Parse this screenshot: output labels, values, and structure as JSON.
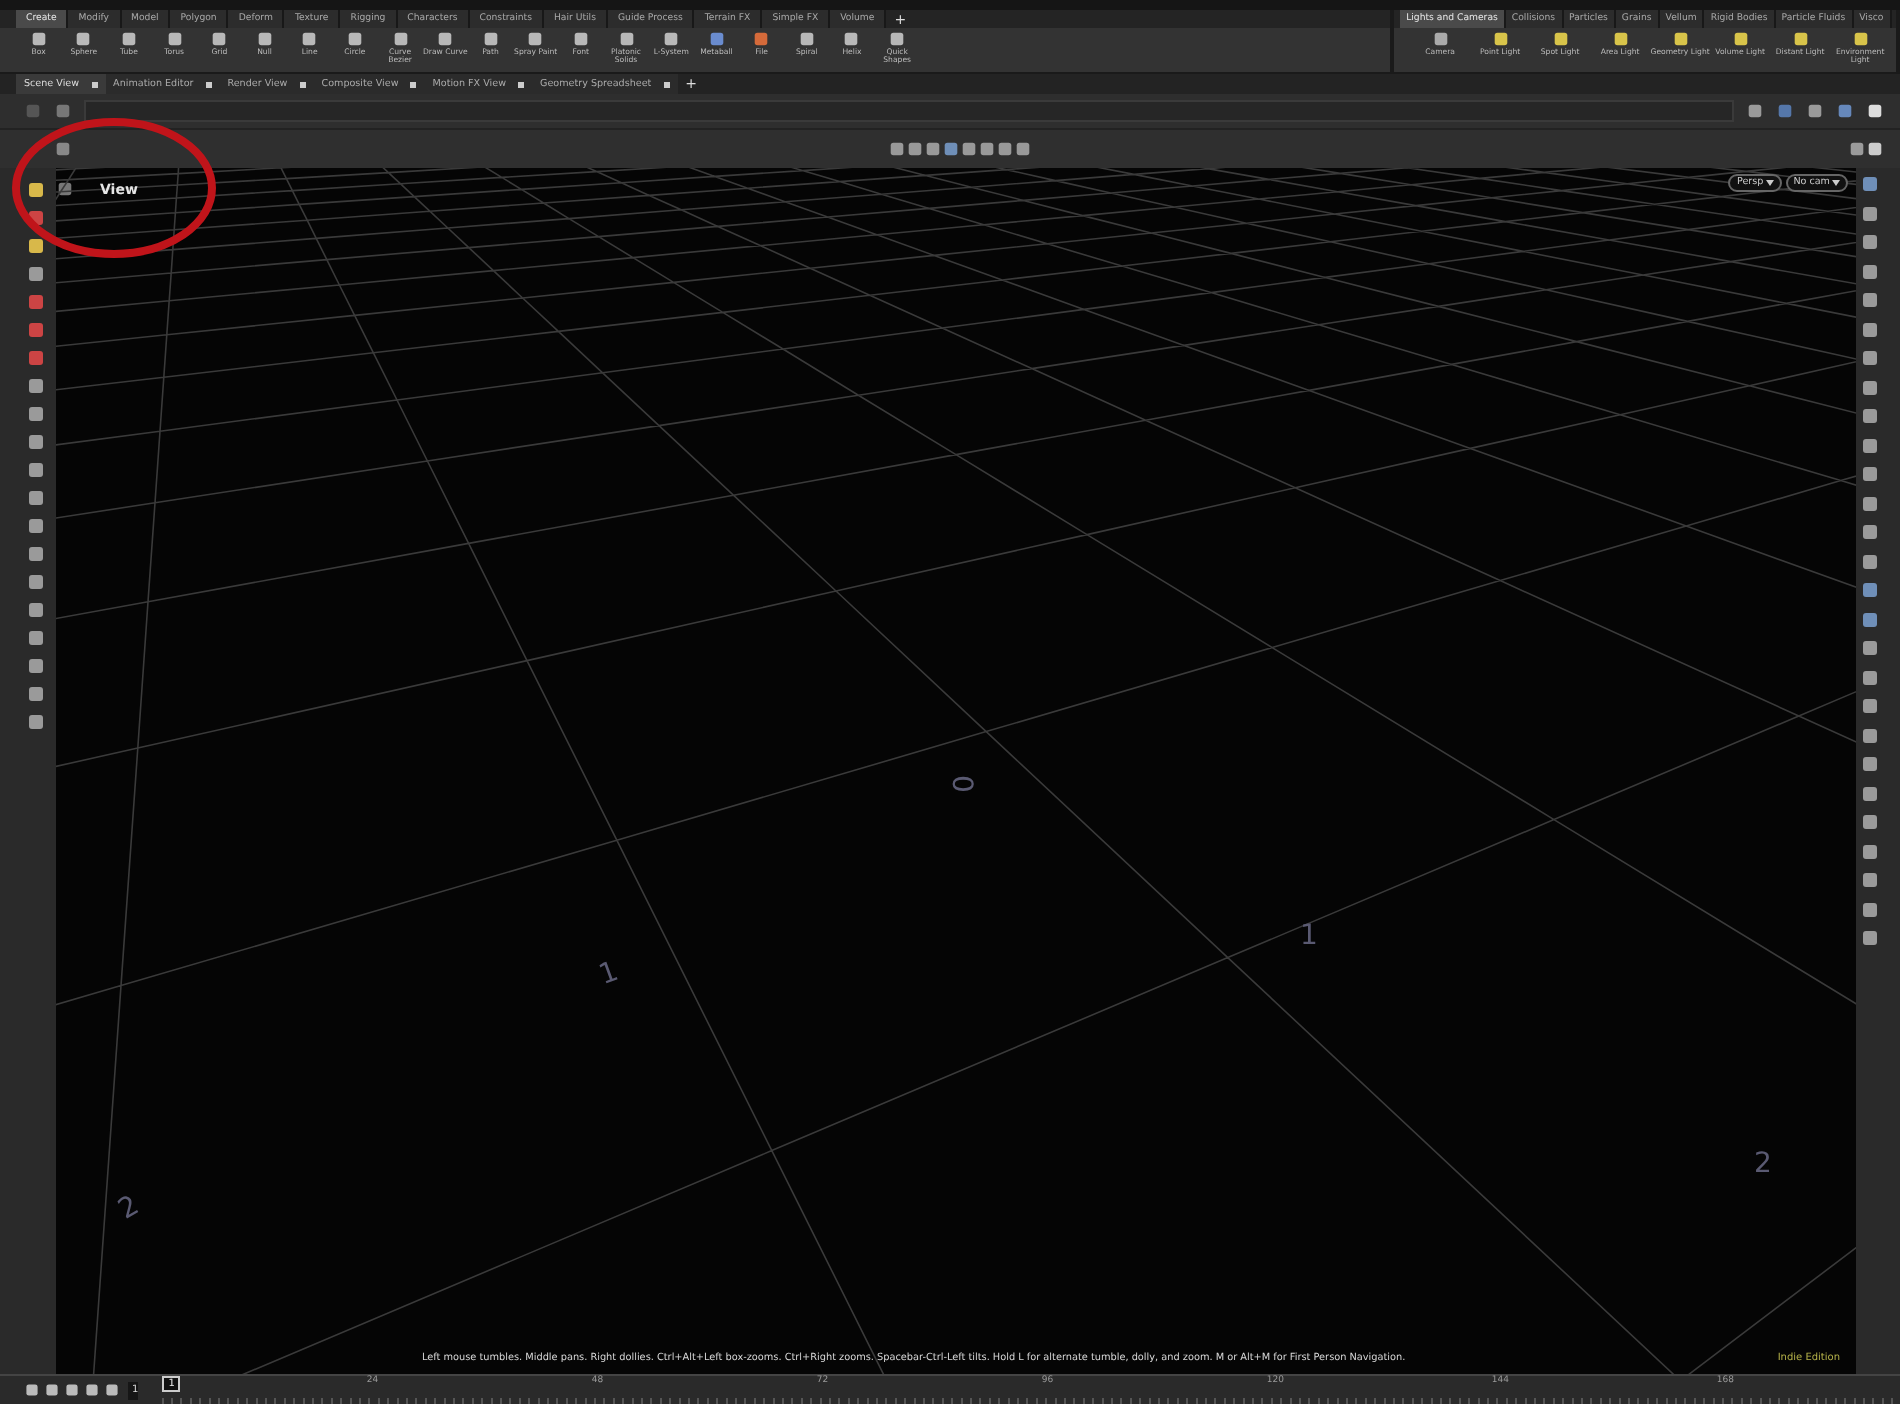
{
  "shelf_tabs": [
    {
      "label": "Create",
      "selected": true
    },
    {
      "label": "Modify",
      "selected": false
    },
    {
      "label": "Model",
      "selected": false
    },
    {
      "label": "Polygon",
      "selected": false
    },
    {
      "label": "Deform",
      "selected": false
    },
    {
      "label": "Texture",
      "selected": false
    },
    {
      "label": "Rigging",
      "selected": false
    },
    {
      "label": "Characters",
      "selected": false
    },
    {
      "label": "Constraints",
      "selected": false
    },
    {
      "label": "Hair Utils",
      "selected": false
    },
    {
      "label": "Guide Process",
      "selected": false
    },
    {
      "label": "Terrain FX",
      "selected": false
    },
    {
      "label": "Simple FX",
      "selected": false
    },
    {
      "label": "Volume",
      "selected": false
    }
  ],
  "shelf_add": "+",
  "shelf_tools": [
    "Box",
    "Sphere",
    "Tube",
    "Torus",
    "Grid",
    "Null",
    "Line",
    "Circle",
    "Curve Bezier",
    "Draw Curve",
    "Path",
    "Spray Paint",
    "Font",
    "Platonic Solids",
    "L-System",
    "Metaball",
    "File",
    "Spiral",
    "Helix",
    "Quick Shapes"
  ],
  "light_tabs": [
    {
      "label": "Lights and Cameras",
      "selected": true
    },
    {
      "label": "Collisions",
      "selected": false
    },
    {
      "label": "Particles",
      "selected": false
    },
    {
      "label": "Grains",
      "selected": false
    },
    {
      "label": "Vellum",
      "selected": false
    },
    {
      "label": "Rigid Bodies",
      "selected": false
    },
    {
      "label": "Particle Fluids",
      "selected": false
    },
    {
      "label": "Visco",
      "selected": false
    }
  ],
  "light_tools": [
    "Camera",
    "Point Light",
    "Spot Light",
    "Area Light",
    "Geometry Light",
    "Volume Light",
    "Distant Light",
    "Environment Light"
  ],
  "pane_tabs": [
    {
      "label": "Scene View",
      "selected": true
    },
    {
      "label": "Animation Editor",
      "selected": false
    },
    {
      "label": "Render View",
      "selected": false
    },
    {
      "label": "Composite View",
      "selected": false
    },
    {
      "label": "Motion FX View",
      "selected": false
    },
    {
      "label": "Geometry Spreadsheet",
      "selected": false
    }
  ],
  "pane_add": "+",
  "viewport": {
    "title": "View",
    "camera_buttons": [
      "Persp",
      "No cam"
    ],
    "grid_labels": [
      "0",
      "1",
      "1",
      "2",
      "2"
    ],
    "status_text": "Left mouse tumbles. Middle pans. Right dollies. Ctrl+Alt+Left box-zooms. Ctrl+Right zooms. Spacebar-Ctrl-Left tilts. Hold L for alternate tumble, dolly, and zoom. M or Alt+M for First Person Navigation.",
    "edition": "Indie Edition"
  },
  "timeline": {
    "frame": "1",
    "current": "1",
    "ticks": [
      "24",
      "48",
      "72",
      "96",
      "120",
      "144",
      "168"
    ]
  }
}
